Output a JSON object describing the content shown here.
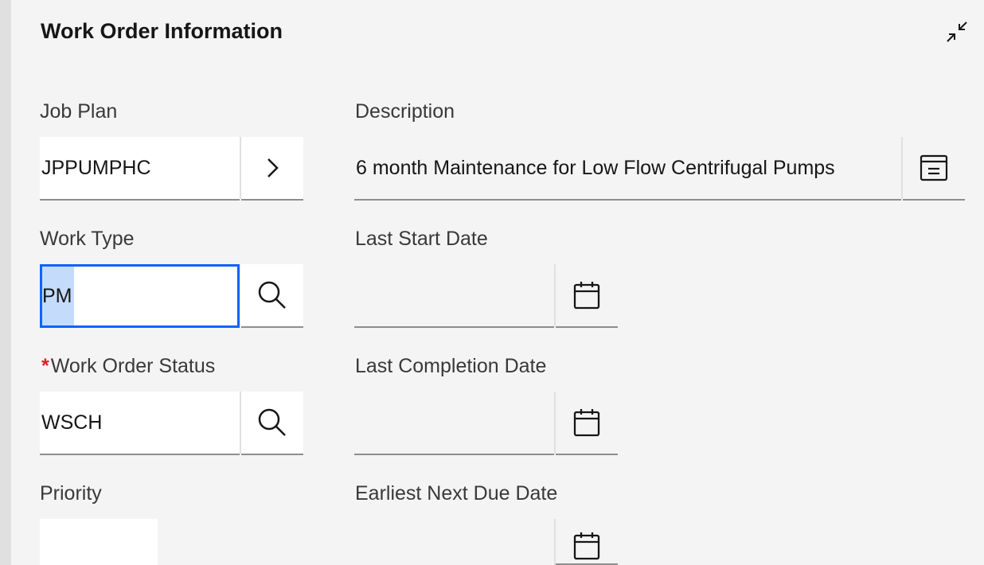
{
  "section": {
    "title": "Work Order Information",
    "collapse_icon": "collapse-arrows-icon"
  },
  "fields": {
    "job_plan": {
      "label": "Job Plan",
      "value": "JPPUMPHC",
      "action_icon": "chevron-right-icon"
    },
    "description": {
      "label": "Description",
      "value": "6 month Maintenance for Low Flow Centrifugal Pumps",
      "action_icon": "long-description-icon"
    },
    "work_type": {
      "label": "Work Type",
      "value": "PM",
      "action_icon": "search-icon"
    },
    "last_start_date": {
      "label": "Last Start Date",
      "value": "",
      "action_icon": "calendar-icon"
    },
    "work_order_status": {
      "required_mark": "*",
      "label": "Work Order Status",
      "value": "WSCH",
      "action_icon": "search-icon"
    },
    "last_completion_date": {
      "label": "Last Completion Date",
      "value": "",
      "action_icon": "calendar-icon"
    },
    "priority": {
      "label": "Priority",
      "value": ""
    },
    "earliest_next_due_date": {
      "label": "Earliest Next Due Date",
      "value": "",
      "action_icon": "calendar-icon"
    }
  },
  "colors": {
    "focus": "#0f62fe",
    "required": "#da1e28",
    "selection": "#c4dbfc"
  }
}
